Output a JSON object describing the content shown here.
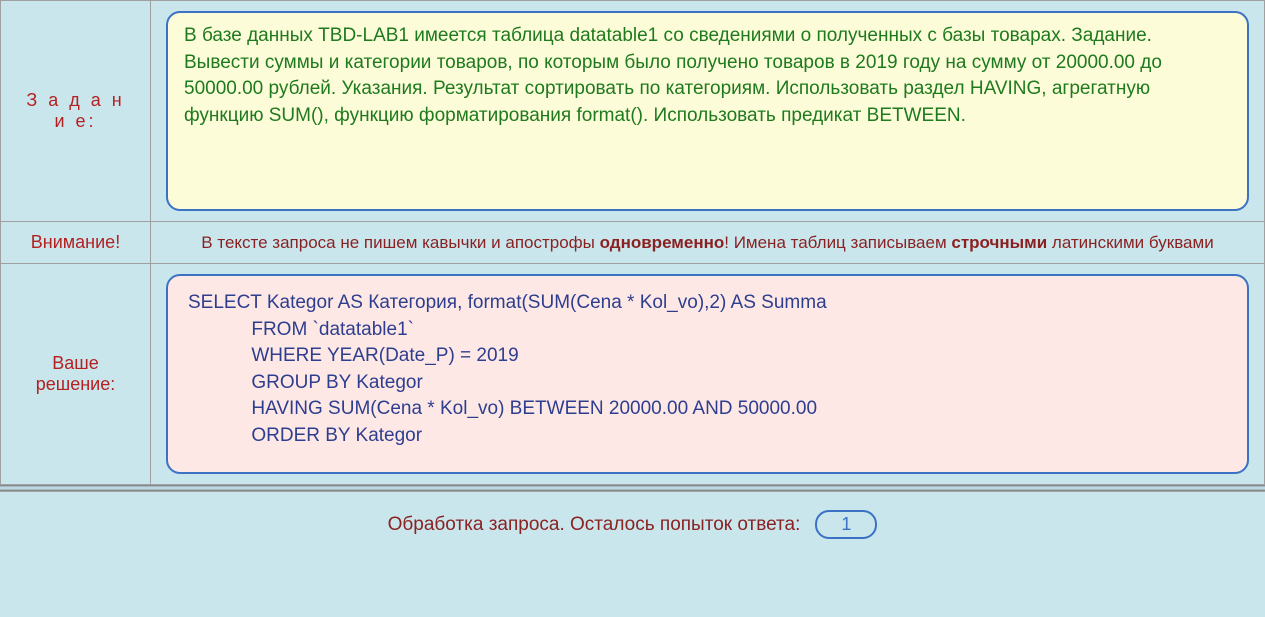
{
  "rows": {
    "task": {
      "label": "З а д а н и е:",
      "text": "В базе данных TBD-LAB1 имеется таблица datatable1 со сведениями о полученных с базы товарах. Задание. Вывести суммы и категории товаров, по которым было получено товаров в 2019 году на сумму от 20000.00 до 50000.00 рублей. Указания. Результат сортировать по категориям. Использовать раздел HAVING, агрегатную функцию SUM(), функцию форматирования format(). Использовать предикат BETWEEN."
    },
    "warning": {
      "label": "Внимание!",
      "text_before": "В тексте запроса не пишем кавычки и апострофы ",
      "bold1": "одновременно",
      "text_middle": "! Имена таблиц записываем ",
      "bold2": "строчными",
      "text_after": " латинскими буквами"
    },
    "solution": {
      "label": "Ваше решение:",
      "sql": "SELECT Kategor AS Категория, format(SUM(Cena * Kol_vo),2) AS Summa\n            FROM `datatable1`\n            WHERE YEAR(Date_P) = 2019\n            GROUP BY Kategor\n            HAVING SUM(Cena * Kol_vo) BETWEEN 20000.00 AND 50000.00\n            ORDER BY Kategor"
    }
  },
  "footer": {
    "text": "Обработка запроса. Осталось попыток ответа:",
    "attempts": "1"
  }
}
